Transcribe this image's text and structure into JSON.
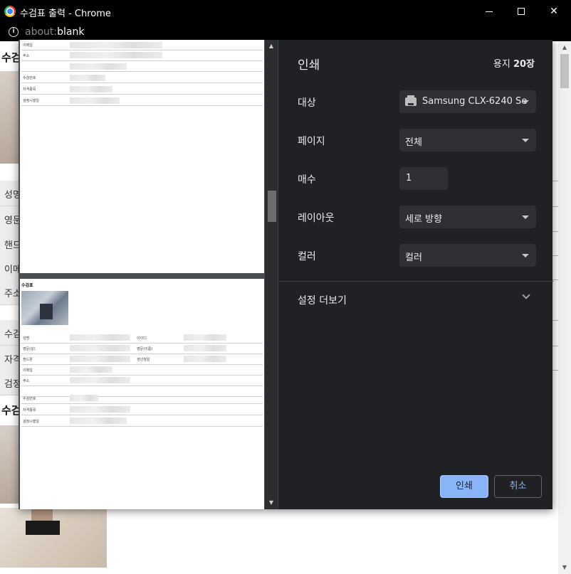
{
  "window": {
    "title": "수검표 출력 - Chrome",
    "url_scheme": "about:",
    "url_rest": "blank"
  },
  "background_page": {
    "heading_top": "수검",
    "heading_bottom": "수검",
    "rows": [
      "성명",
      "영문",
      "핸드",
      "이메",
      "주소",
      "수검",
      "자격",
      "검정"
    ]
  },
  "preview": {
    "sheet1_fields": [
      "이메일",
      "주소",
      "수검번호",
      "자격종목",
      "검정시행일"
    ],
    "sheet2_title": "수검표",
    "sheet2_fields": [
      "성명",
      "영문(성)",
      "핸드폰",
      "이메일",
      "주소",
      "수검번호",
      "자격종목",
      "검정시행일"
    ],
    "sheet2_right_fields": [
      "아이디",
      "영문(이름)",
      "생년월일"
    ]
  },
  "print_settings": {
    "title": "인쇄",
    "sheets_label": "용지",
    "sheets_count": "20장",
    "destination_label": "대상",
    "destination_value": "Samsung CLX-6240 Se",
    "pages_label": "페이지",
    "pages_value": "전체",
    "copies_label": "매수",
    "copies_value": "1",
    "layout_label": "레이아웃",
    "layout_value": "세로 방향",
    "color_label": "컬러",
    "color_value": "컬러",
    "more_settings_label": "설정 더보기",
    "print_button": "인쇄",
    "cancel_button": "취소"
  },
  "colors": {
    "dialog_bg": "#202124",
    "accent": "#8ab4f8",
    "preview_bg": "#4a4d50"
  }
}
